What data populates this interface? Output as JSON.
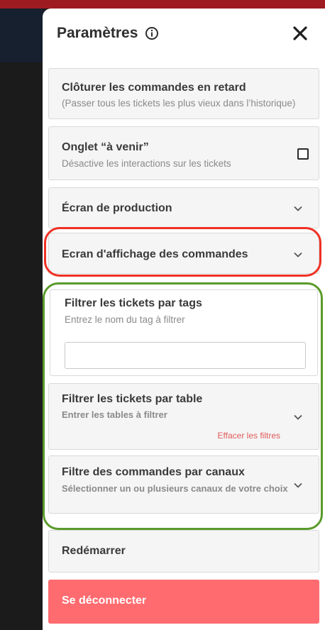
{
  "panel": {
    "title": "Paramètres",
    "info_icon": "info-circle-icon",
    "close_icon": "close-icon"
  },
  "cards": {
    "close_late": {
      "title": "Clôturer les commandes en retard",
      "subtitle": "(Passer tous les tickets les plus vieux dans l’historique)"
    },
    "upcoming_tab": {
      "title": "Onglet “à venir”",
      "subtitle": "Désactive les interactions sur les tickets",
      "checked": false
    },
    "production_screen": {
      "title": "Écran de production"
    },
    "order_display": {
      "title": "Ecran d'affichage des commandes"
    },
    "filter_tags": {
      "title": "Filtrer les tickets par tags",
      "subtitle": "Entrez le nom du tag à filtrer",
      "input_value": ""
    },
    "filter_table": {
      "title": "Filtrer les tickets par table",
      "subtitle": "Entrer les tables à filtrer",
      "clear_label": "Effacer les filtres"
    },
    "filter_channels": {
      "title": "Filtre des commandes par canaux",
      "subtitle": "Sélectionner un ou plusieurs canaux de votre choix"
    },
    "restart": {
      "title": "Redémarrer"
    }
  },
  "logout_label": "Se déconnecter",
  "colors": {
    "logout_bg": "#ff6b6f",
    "highlight_red": "#ee3124",
    "highlight_green": "#5a9a2a",
    "clear_link": "#e05a5a"
  }
}
